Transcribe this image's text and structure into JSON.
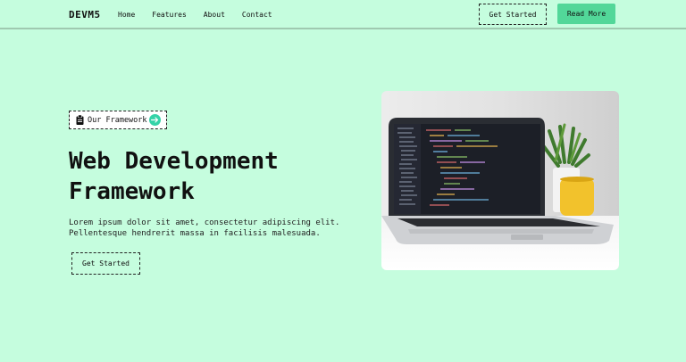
{
  "header": {
    "logo": "DEVM5",
    "nav": [
      "Home",
      "Features",
      "About",
      "Contact"
    ],
    "get_started_label": "Get Started",
    "read_more_label": "Read More"
  },
  "hero": {
    "badge_label": "Our Framework",
    "badge_icon": "clipboard-icon",
    "badge_arrow_icon": "arrow-right-icon",
    "title_line1": "Web Development",
    "title_line2": "Framework",
    "desc_line1": "Lorem ipsum dolor sit amet, consectetur adipiscing elit.",
    "desc_line2": "Pellentesque hendrerit massa in facilisis malesuada.",
    "cta_label": "Get Started"
  },
  "colors": {
    "background": "#c5fdde",
    "accent": "#52d799",
    "badge_arrow": "#34d3a8"
  }
}
